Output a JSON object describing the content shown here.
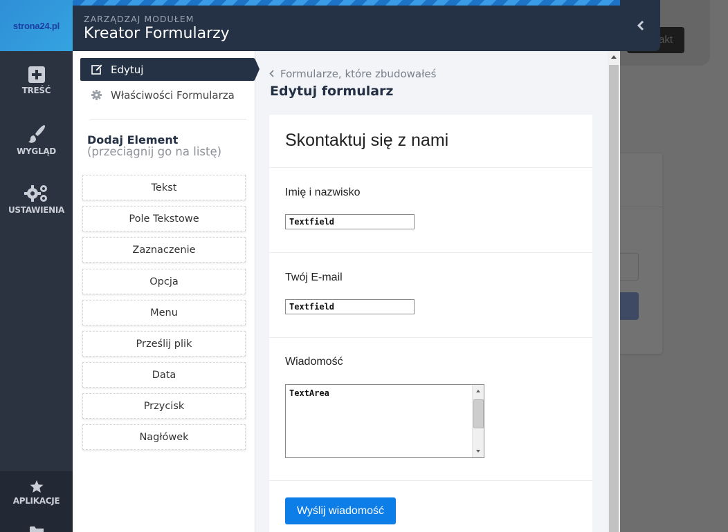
{
  "app": {
    "logo_text": "strona24.pl",
    "accent_color": "#0d7de8",
    "nav_dark": "#253245"
  },
  "rail": {
    "items": [
      {
        "label": "TREŚĆ",
        "icon": "plus-square-icon"
      },
      {
        "label": "WYGLĄD",
        "icon": "paintbrush-icon"
      },
      {
        "label": "USTAWIENIA",
        "icon": "gears-icon"
      },
      {
        "label": "APLIKACJE",
        "icon": "star-icon"
      }
    ],
    "more_icon": "folder-icon"
  },
  "panel": {
    "subtitle": "ZARZĄDZAJ MODUŁEM",
    "title": "Kreator Formularzy",
    "collapse_icon": "chevron-left-icon"
  },
  "background": {
    "button_label": "akt"
  },
  "sidebar": {
    "tabs": [
      {
        "label": "Edytuj",
        "icon": "edit-icon",
        "active": true
      },
      {
        "label": "Właściwości Formularza",
        "icon": "gear-icon",
        "active": false
      }
    ],
    "add_title": "Dodaj Element",
    "add_subtitle": "(przeciągnij go na listę)",
    "elements": [
      "Tekst",
      "Pole Tekstowe",
      "Zaznaczenie",
      "Opcja",
      "Menu",
      "Prześlij plik",
      "Data",
      "Przycisk",
      "Nagłówek"
    ]
  },
  "content": {
    "breadcrumb": "Formularze, które zbudowałeś",
    "title": "Edytuj formularz",
    "form": {
      "heading": "Skontaktuj się z nami",
      "fields": [
        {
          "label": "Imię i nazwisko",
          "type": "Textfield"
        },
        {
          "label": "Twój E-mail",
          "type": "Textfield"
        },
        {
          "label": "Wiadomość",
          "type": "TextArea"
        }
      ],
      "submit_label": "Wyślij wiadomość"
    }
  }
}
